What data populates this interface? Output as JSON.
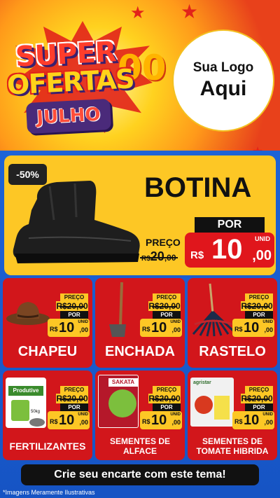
{
  "hero": {
    "super": "SUPER",
    "ofertas": "OFERTAS",
    "zeros": "00",
    "month": "JULHO",
    "logo_line1": "Sua Logo",
    "logo_line2": "Aqui"
  },
  "featured": {
    "discount": "-50%",
    "title": "BOTINA",
    "price_label": "PREÇO",
    "old_currency": "R$",
    "old_value": "20",
    "old_cents": ",00",
    "por_label": "POR",
    "unid_label": "UNID",
    "new_currency": "R$",
    "new_value": "10",
    "new_cents": ",00"
  },
  "products": [
    {
      "name": "CHAPEU",
      "preco": "PREÇO",
      "old": "R$20,00",
      "por": "POR",
      "cur": "R$",
      "val": "10",
      "cents": ",00",
      "unid": "UNID"
    },
    {
      "name": "ENCHADA",
      "preco": "PREÇO",
      "old": "R$20,00",
      "por": "POR",
      "cur": "R$",
      "val": "10",
      "cents": ",00",
      "unid": "UNID"
    },
    {
      "name": "RASTELO",
      "preco": "PREÇO",
      "old": "R$20,00",
      "por": "POR",
      "cur": "R$",
      "val": "10",
      "cents": ",00",
      "unid": "UNID"
    },
    {
      "name": "FERTILIZANTES",
      "preco": "PREÇO",
      "old": "R$20,00",
      "por": "POR",
      "cur": "R$",
      "val": "10",
      "cents": ",00",
      "unid": "UNID"
    },
    {
      "name": "SEMENTES DE",
      "name2": "ALFACE",
      "preco": "PREÇO",
      "old": "R$20,00",
      "por": "POR",
      "cur": "R$",
      "val": "10",
      "cents": ",00",
      "unid": "UNID"
    },
    {
      "name": "SEMENTES DE",
      "name2": "TOMATE HIBRIDA",
      "preco": "PREÇO",
      "old": "R$20,00",
      "por": "POR",
      "cur": "R$",
      "val": "10",
      "cents": ",00",
      "unid": "UNID"
    }
  ],
  "packaging": {
    "fert_brand": "Produtive",
    "fert_weight": "50kg",
    "sakata": "SAKATA",
    "seed_brand": "agristar"
  },
  "footer": {
    "cta": "Crie seu encarte com este tema!",
    "disclaimer": "*Imagens Meramente Ilustrativas"
  },
  "colors": {
    "accent_red": "#d2161b",
    "accent_yellow": "#fdc725",
    "background_blue": "#1a5fd0"
  }
}
